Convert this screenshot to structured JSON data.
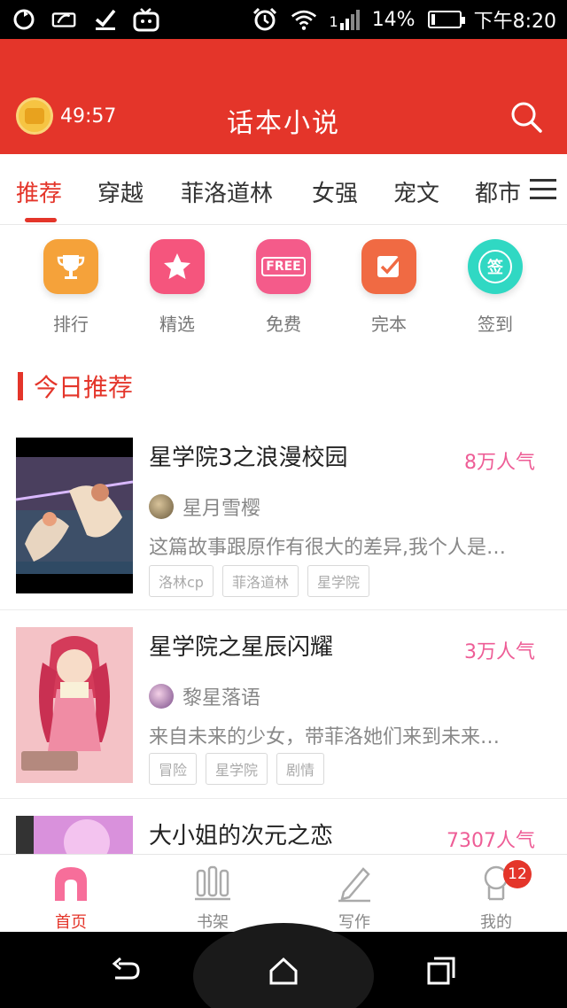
{
  "status_bar": {
    "signal_label": "1",
    "battery_text": "14%",
    "battery_level": 0.14,
    "time": "下午8:20"
  },
  "header": {
    "timer": "49:57",
    "title": "话本小说"
  },
  "tabs": [
    {
      "label": "推荐"
    },
    {
      "label": "穿越"
    },
    {
      "label": "菲洛道林"
    },
    {
      "label": "女强"
    },
    {
      "label": "宠文"
    },
    {
      "label": "都市"
    }
  ],
  "quick_entries": [
    {
      "label": "排行",
      "icon": "trophy-icon",
      "color": "#f5a23a"
    },
    {
      "label": "精选",
      "icon": "star-icon",
      "color": "#f5557d"
    },
    {
      "label": "免费",
      "icon": "free-icon",
      "icon_text": "FREE",
      "color": "#f45b8a"
    },
    {
      "label": "完本",
      "icon": "check-icon",
      "color": "#f06a43"
    },
    {
      "label": "签到",
      "icon": "sign-in-icon",
      "icon_text": "签",
      "color": "#30d8c3"
    }
  ],
  "section": {
    "title": "今日推荐"
  },
  "books": [
    {
      "title": "星学院3之浪漫校园",
      "popularity": "8万人气",
      "author": "星月雪樱",
      "desc": "这篇故事跟原作有很大的差异,我个人是…",
      "tags": [
        "洛林cp",
        "菲洛道林",
        "星学院"
      ]
    },
    {
      "title": "星学院之星辰闪耀",
      "popularity": "3万人气",
      "author": "黎星落语",
      "desc": "来自未来的少女，带菲洛她们来到未来…",
      "tags": [
        "冒险",
        "星学院",
        "剧情"
      ]
    },
    {
      "title": "大小姐的次元之恋",
      "popularity": "7307人气"
    }
  ],
  "bottom_nav": [
    {
      "label": "首页",
      "icon": "home-icon"
    },
    {
      "label": "书架",
      "icon": "bookshelf-icon"
    },
    {
      "label": "写作",
      "icon": "pen-icon"
    },
    {
      "label": "我的",
      "icon": "profile-icon",
      "badge": "12"
    }
  ],
  "colors": {
    "accent": "#e4352a",
    "popularity": "#ee5d96"
  }
}
